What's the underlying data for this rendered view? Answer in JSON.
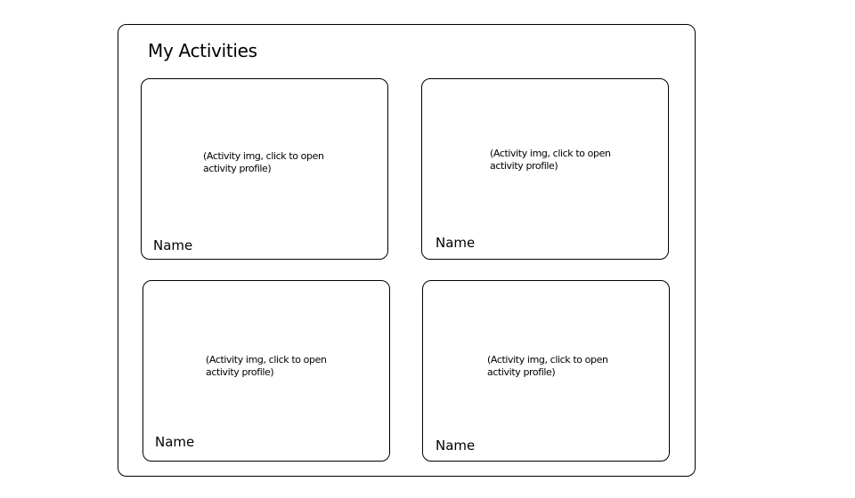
{
  "page": {
    "title": "My Activities"
  },
  "activities": [
    {
      "caption": "(Activity img, click to open activity profile)",
      "name": "Name"
    },
    {
      "caption": "(Activity img, click to open activity profile)",
      "name": "Name"
    },
    {
      "caption": "(Activity img, click to open activity profile)",
      "name": "Name"
    },
    {
      "caption": "(Activity img, click to open activity profile)",
      "name": "Name"
    }
  ]
}
